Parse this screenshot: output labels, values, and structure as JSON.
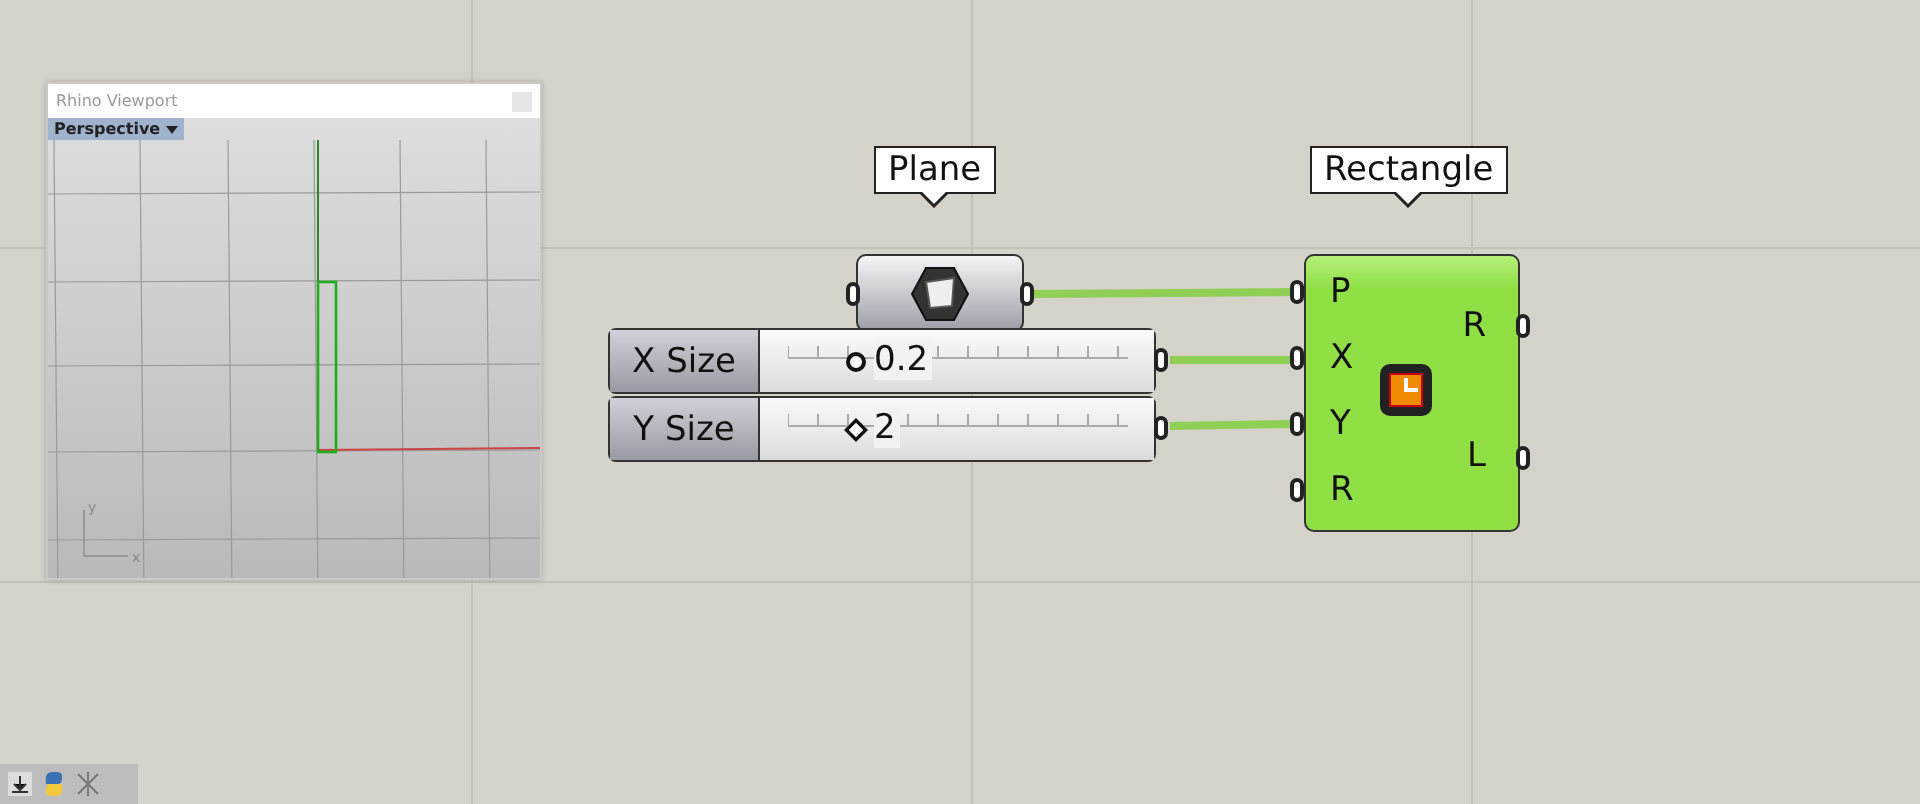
{
  "viewport": {
    "title": "Rhino Viewport",
    "view_tab": "Perspective",
    "axis_labels": [
      "y",
      "x"
    ]
  },
  "plane_node": {
    "tooltip": "Plane"
  },
  "sliders": [
    {
      "label": "X Size",
      "value": "0.2",
      "level": 0.2,
      "kind": "circle"
    },
    {
      "label": "Y Size",
      "value": "2",
      "level": 0.2,
      "kind": "diamond"
    }
  ],
  "rectangle_node": {
    "tooltip": "Rectangle",
    "inputs": [
      "P",
      "X",
      "Y",
      "R"
    ],
    "outputs": [
      "R",
      "L"
    ]
  }
}
